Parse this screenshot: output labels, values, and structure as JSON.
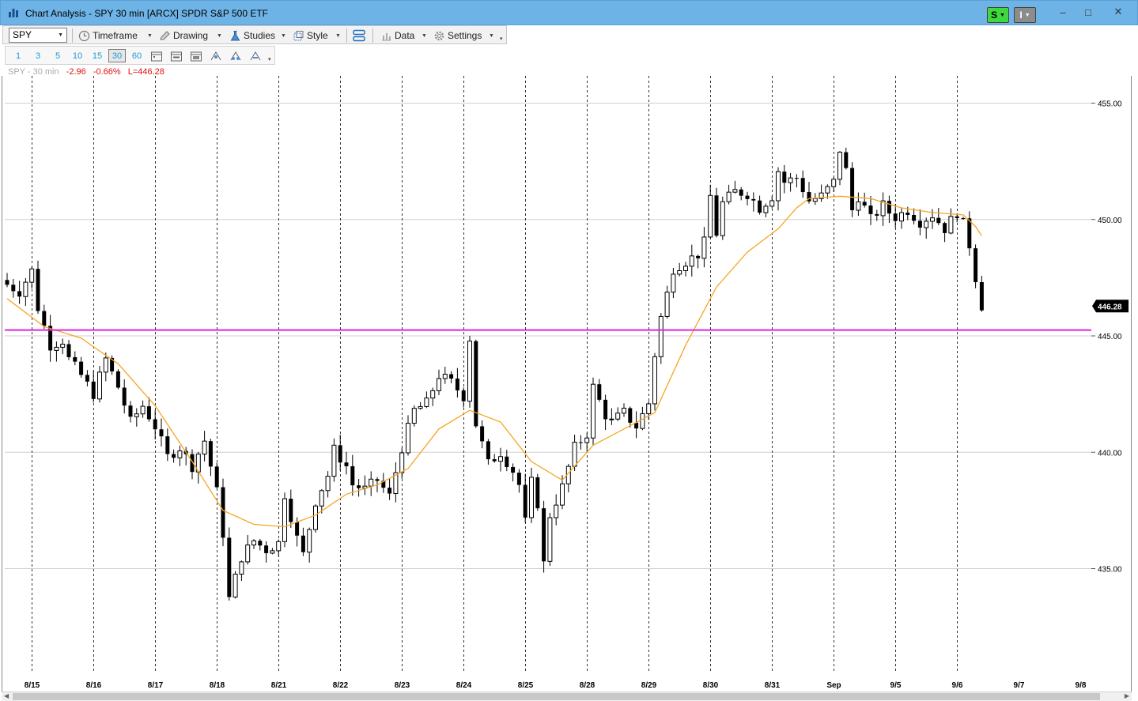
{
  "window": {
    "title": "Chart Analysis - SPY 30 min [ARCX] SPDR S&P 500 ETF",
    "badge_s": "S",
    "badge_i": "I",
    "minimize": "–",
    "maximize": "□",
    "close": "✕"
  },
  "toolbar": {
    "symbol": "SPY",
    "timeframe": "Timeframe",
    "drawing": "Drawing",
    "studies": "Studies",
    "style": "Style",
    "data": "Data",
    "settings": "Settings"
  },
  "intervals": [
    "1",
    "3",
    "5",
    "10",
    "15",
    "30",
    "60"
  ],
  "active_interval": "30",
  "legend": {
    "symbol": "SPY - 30 min",
    "change": "-2.96",
    "change_pct": "-0.66%",
    "last": "L=446.28"
  },
  "colors": {
    "candles": "#000000",
    "moving_average": "#f5a623",
    "horizontal_line": "#e020e0",
    "last_price_tag": "#000000",
    "change_text": "#e01010"
  },
  "chart_data": {
    "type": "candlestick",
    "interval": "30 min",
    "x_dates": [
      "8/15",
      "8/16",
      "8/17",
      "8/18",
      "8/21",
      "8/22",
      "8/23",
      "8/24",
      "8/25",
      "8/28",
      "8/29",
      "8/30",
      "8/31",
      "Sep",
      "9/5",
      "9/6",
      "9/7",
      "9/8"
    ],
    "y_ticks": [
      "455.00",
      "450.00",
      "445.00",
      "440.00",
      "435.00"
    ],
    "ylim": [
      431.5,
      456.2
    ],
    "last_price": "446.28",
    "horizontal_line": 445.25,
    "close_path": [
      [
        0,
        447.2
      ],
      [
        2,
        446.9
      ],
      [
        4,
        447.8
      ],
      [
        5,
        446.2
      ],
      [
        7,
        444.6
      ],
      [
        9,
        444.8
      ],
      [
        10,
        444.0
      ],
      [
        12,
        443.3
      ],
      [
        14,
        442.5
      ],
      [
        16,
        444.0
      ],
      [
        18,
        442.8
      ],
      [
        20,
        441.3
      ],
      [
        22,
        442.0
      ],
      [
        24,
        441.1
      ],
      [
        26,
        439.8
      ],
      [
        28,
        440.2
      ],
      [
        30,
        439.4
      ],
      [
        32,
        440.5
      ],
      [
        34,
        438.3
      ],
      [
        35,
        436.5
      ],
      [
        36,
        433.7
      ],
      [
        38,
        435.5
      ],
      [
        40,
        436.2
      ],
      [
        42,
        435.8
      ],
      [
        44,
        436.1
      ],
      [
        45,
        438.2
      ],
      [
        47,
        436.3
      ],
      [
        48,
        435.6
      ],
      [
        50,
        437.9
      ],
      [
        52,
        439.0
      ],
      [
        53,
        440.1
      ],
      [
        55,
        439.4
      ],
      [
        56,
        438.6
      ],
      [
        58,
        438.4
      ],
      [
        60,
        438.8
      ],
      [
        62,
        438.1
      ],
      [
        64,
        440.2
      ],
      [
        66,
        441.8
      ],
      [
        68,
        442.1
      ],
      [
        70,
        443.3
      ],
      [
        72,
        443.0
      ],
      [
        74,
        442.4
      ],
      [
        75,
        444.9
      ],
      [
        76,
        441.2
      ],
      [
        78,
        439.5
      ],
      [
        80,
        440.0
      ],
      [
        82,
        439.2
      ],
      [
        83,
        438.6
      ],
      [
        84,
        437.0
      ],
      [
        85,
        438.7
      ],
      [
        86,
        437.8
      ],
      [
        87,
        435.2
      ],
      [
        88,
        437.3
      ],
      [
        90,
        438.5
      ],
      [
        92,
        440.2
      ],
      [
        94,
        440.8
      ],
      [
        95,
        442.8
      ],
      [
        97,
        441.6
      ],
      [
        98,
        441.3
      ],
      [
        100,
        441.7
      ],
      [
        102,
        441.1
      ],
      [
        104,
        442.1
      ],
      [
        105,
        444.2
      ],
      [
        106,
        445.8
      ],
      [
        107,
        446.8
      ],
      [
        108,
        447.9
      ],
      [
        110,
        448.2
      ],
      [
        112,
        448.5
      ],
      [
        113,
        449.0
      ],
      [
        114,
        451.0
      ],
      [
        115,
        449.4
      ],
      [
        116,
        450.7
      ],
      [
        118,
        451.2
      ],
      [
        120,
        451.1
      ],
      [
        122,
        450.5
      ],
      [
        124,
        451.0
      ],
      [
        125,
        452.1
      ],
      [
        126,
        451.6
      ],
      [
        128,
        451.8
      ],
      [
        130,
        450.8
      ],
      [
        132,
        451.0
      ],
      [
        134,
        451.6
      ],
      [
        135,
        453.0
      ],
      [
        136,
        452.1
      ],
      [
        137,
        450.4
      ],
      [
        138,
        451.0
      ],
      [
        140,
        450.0
      ],
      [
        142,
        450.6
      ],
      [
        143,
        450.3
      ],
      [
        144,
        450.1
      ],
      [
        146,
        450.4
      ],
      [
        148,
        449.9
      ],
      [
        150,
        450.2
      ],
      [
        152,
        449.6
      ],
      [
        154,
        450.3
      ],
      [
        155,
        449.8
      ],
      [
        156,
        448.9
      ],
      [
        157,
        447.5
      ],
      [
        158,
        446.3
      ]
    ],
    "ma_path": [
      [
        0,
        446.6
      ],
      [
        6,
        445.4
      ],
      [
        12,
        444.9
      ],
      [
        18,
        443.8
      ],
      [
        24,
        442.0
      ],
      [
        30,
        439.6
      ],
      [
        35,
        437.5
      ],
      [
        40,
        436.9
      ],
      [
        45,
        436.8
      ],
      [
        50,
        437.3
      ],
      [
        55,
        438.2
      ],
      [
        60,
        438.6
      ],
      [
        65,
        439.3
      ],
      [
        70,
        441.0
      ],
      [
        75,
        441.8
      ],
      [
        80,
        441.3
      ],
      [
        85,
        439.6
      ],
      [
        90,
        438.8
      ],
      [
        95,
        440.3
      ],
      [
        100,
        441.0
      ],
      [
        105,
        441.7
      ],
      [
        110,
        444.6
      ],
      [
        115,
        447.1
      ],
      [
        120,
        448.6
      ],
      [
        125,
        449.6
      ],
      [
        128,
        450.5
      ],
      [
        130,
        450.9
      ],
      [
        135,
        451.0
      ],
      [
        140,
        450.9
      ],
      [
        145,
        450.5
      ],
      [
        150,
        450.3
      ],
      [
        155,
        450.2
      ],
      [
        157,
        449.7
      ],
      [
        158,
        449.3
      ]
    ]
  }
}
